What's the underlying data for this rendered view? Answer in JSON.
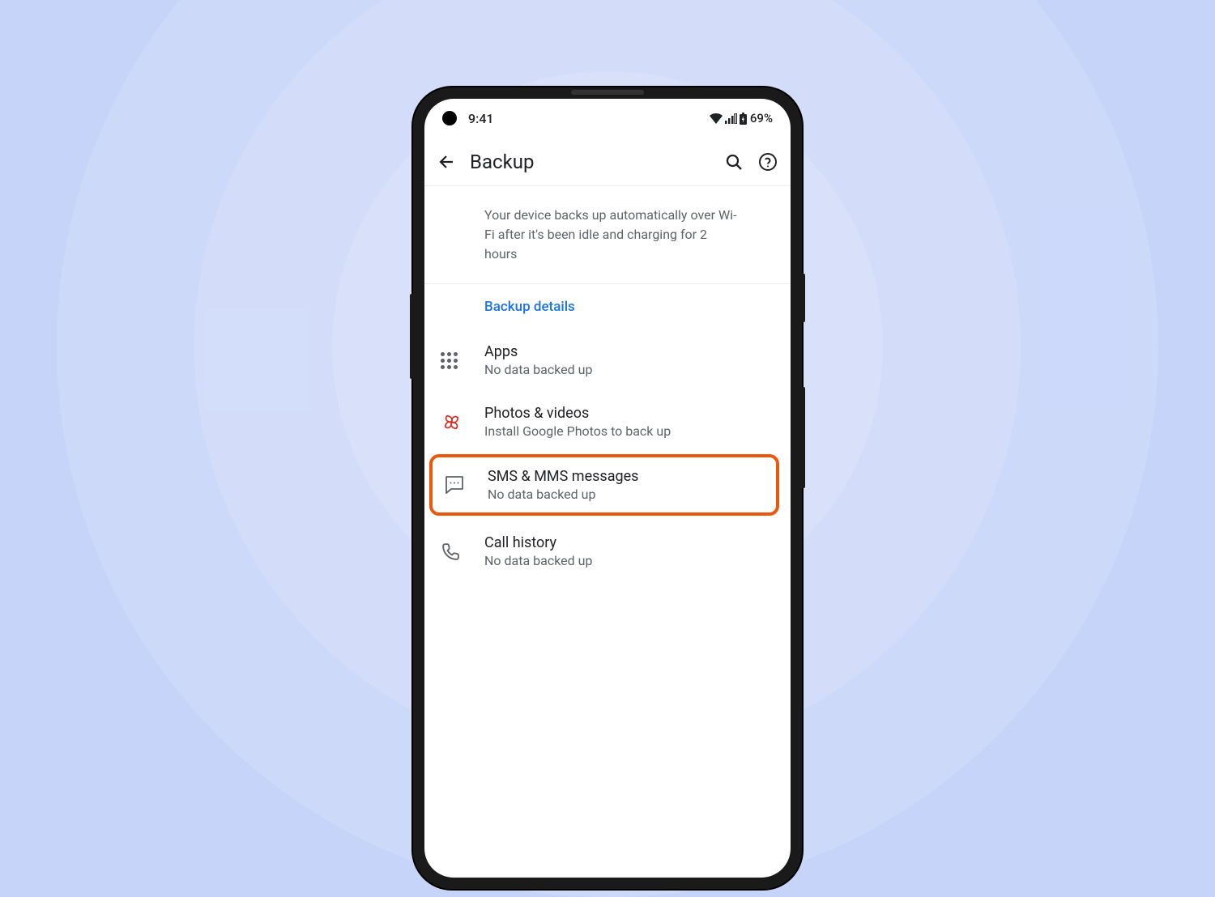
{
  "statusBar": {
    "time": "9:41",
    "battery": "69%"
  },
  "appBar": {
    "title": "Backup"
  },
  "info": {
    "text": "Your device backs up automatically over Wi-Fi after it's been idle and charging for 2 hours"
  },
  "section": {
    "header": "Backup details"
  },
  "items": {
    "apps": {
      "title": "Apps",
      "subtitle": "No data backed up"
    },
    "photos": {
      "title": "Photos & videos",
      "subtitle": "Install Google Photos to back up"
    },
    "sms": {
      "title": "SMS & MMS messages",
      "subtitle": "No data backed up"
    },
    "calls": {
      "title": "Call history",
      "subtitle": "No data backed up"
    }
  }
}
